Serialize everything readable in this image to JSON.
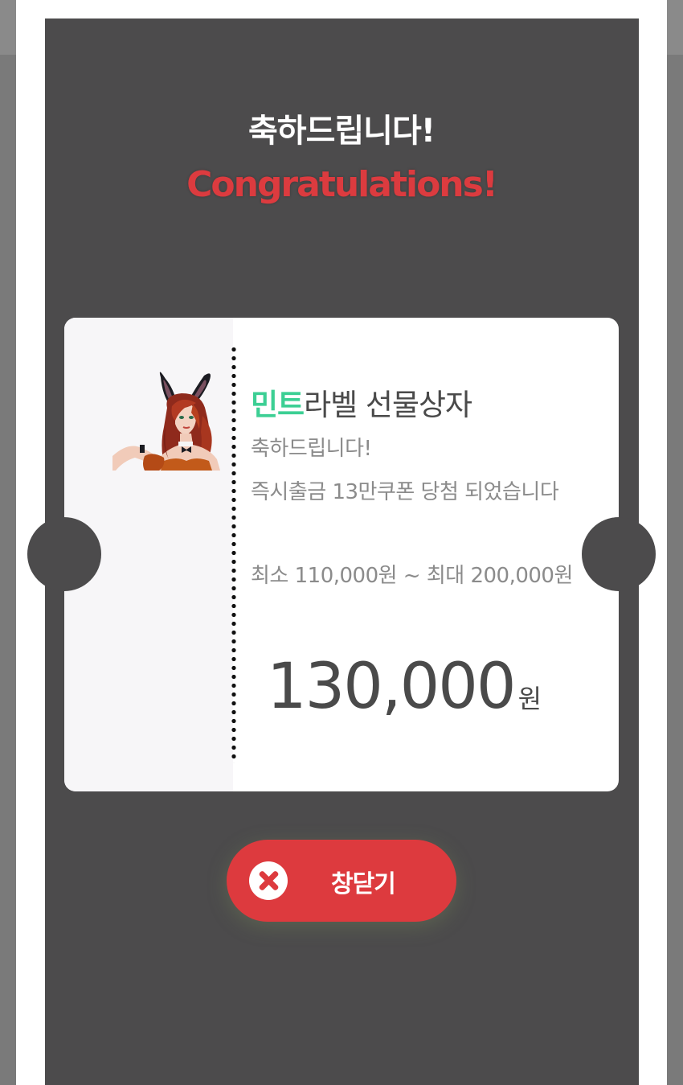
{
  "modal": {
    "title_ko": "축하드립니다!",
    "title_en": "Congratulations!"
  },
  "ticket": {
    "brand_accent": "민트",
    "product_name": "라벨 선물상자",
    "message_line_1": "축하드립니다!",
    "message_line_2": "즉시출금 13만쿠폰 당첨 되었습니다",
    "message_line_3": "최소 110,000원 ~ 최대 200,000원",
    "amount": "130,000",
    "amount_unit": "원"
  },
  "close_button": {
    "label": "창닫기"
  },
  "colors": {
    "accent_red": "#dd3a3e",
    "brand_green": "#3ccf94",
    "modal_background": "#4c4b4c"
  },
  "icons": {
    "close": "close-icon",
    "character": "character-illustration"
  }
}
